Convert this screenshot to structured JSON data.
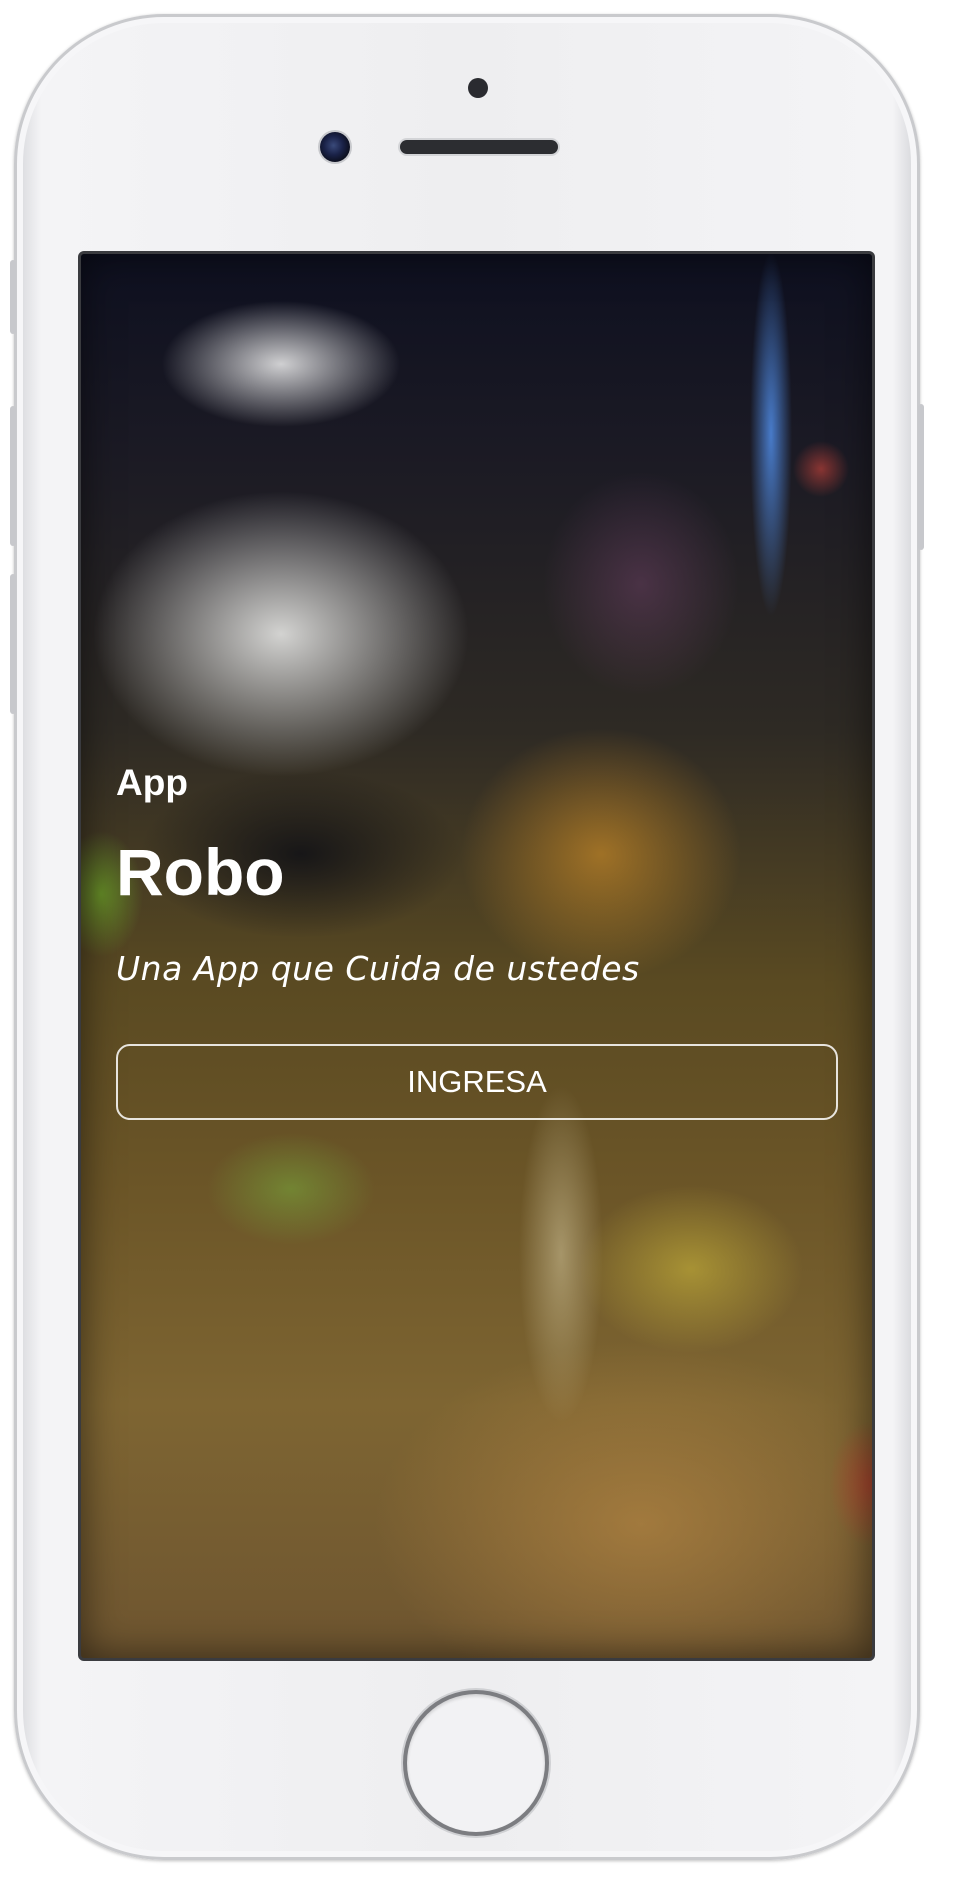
{
  "app": {
    "label": "App",
    "title": "Robo",
    "tagline": "Una App que Cuida de ustedes",
    "login_button_label": "INGRESA"
  },
  "device": {
    "model": "iphone",
    "frame_color": "#eeeef0",
    "screen_border_color": "#3a3b3f"
  },
  "background": {
    "description": "blurred-security-camera-night-street"
  }
}
